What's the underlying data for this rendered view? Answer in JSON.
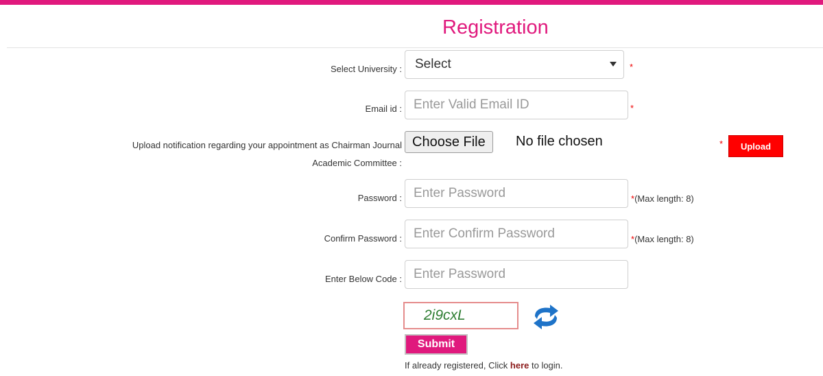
{
  "page": {
    "title": "Registration"
  },
  "form": {
    "university": {
      "label": "Select University :",
      "value": "Select",
      "required_mark": "*"
    },
    "email": {
      "label": "Email id :",
      "placeholder": "Enter Valid Email ID",
      "required_mark": "*"
    },
    "upload": {
      "label_line1": "Upload notification regarding your appointment as Chairman Journal",
      "label_line2": "Academic Committee :",
      "choose_label": "Choose File",
      "file_status": "No file chosen",
      "required_mark": "*",
      "upload_label": "Upload"
    },
    "password": {
      "label": "Password :",
      "placeholder": "Enter Password",
      "required_mark": "*",
      "hint": "(Max length: 8)"
    },
    "confirm_password": {
      "label": "Confirm Password :",
      "placeholder": "Enter Confirm Password",
      "required_mark": "*",
      "hint": "(Max length: 8)"
    },
    "code": {
      "label": "Enter Below Code :",
      "placeholder": "Enter Password"
    },
    "captcha": {
      "text": "2i9cxL",
      "refresh_icon": "refresh-icon"
    },
    "submit_label": "Submit",
    "login": {
      "prefix": "If already registered, Click ",
      "link": "here",
      "suffix": " to login."
    }
  },
  "colors": {
    "accent": "#e0197d",
    "required": "#ee0000",
    "upload_button": "#ff0000",
    "captcha_text": "#2e7d32",
    "refresh_icon": "#1e73c8"
  }
}
